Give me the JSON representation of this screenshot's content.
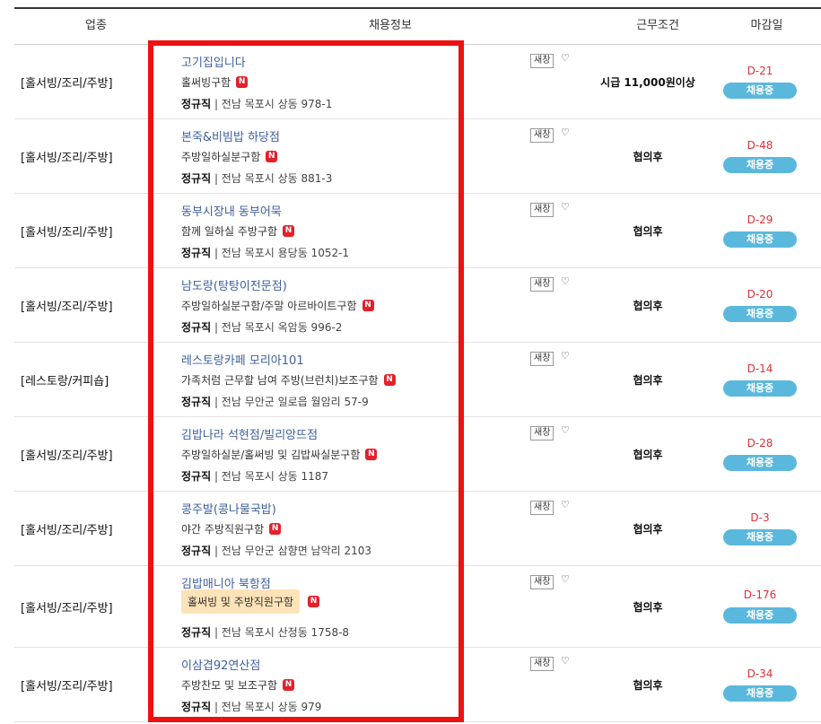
{
  "header": {
    "category": "업종",
    "info": "채용정보",
    "condition": "근무조건",
    "deadline": "마감일"
  },
  "labels": {
    "scrap": "새창",
    "new": "N",
    "heart": "♡"
  },
  "rows": [
    {
      "category": "[홀서빙/조리/주방]",
      "title": "고기집입니다",
      "desc": "홀써빙구함",
      "type": "정규직",
      "location": " | 전남 목포시 상동 978-1",
      "condition": "시급 11,000원이상",
      "dday": "D-21",
      "status": "채용중"
    },
    {
      "category": "[홀서빙/조리/주방]",
      "title": "본죽&비빔밥 하당점",
      "desc": "주방일하실분구함",
      "type": "정규직",
      "location": " | 전남 목포시 상동 881-3",
      "condition": "협의후",
      "dday": "D-48",
      "status": "채용중"
    },
    {
      "category": "[홀서빙/조리/주방]",
      "title": "동부시장내 동부어묵",
      "desc": "함께 일하실 주방구함",
      "type": "정규직",
      "location": " | 전남 목포시 용당동 1052-1",
      "condition": "협의후",
      "dday": "D-29",
      "status": "채용중"
    },
    {
      "category": "[홀서빙/조리/주방]",
      "title": "남도랑(탕탕이전문점)",
      "desc": "주방일하실분구함/주말 아르바이트구함",
      "type": "정규직",
      "location": " | 전남 목포시 옥암동 996-2",
      "condition": "협의후",
      "dday": "D-20",
      "status": "채용중"
    },
    {
      "category": "[레스토랑/커피숍]",
      "title": "레스토랑카페 모리아101",
      "desc": "가족처럼 근무할 남여 주방(브런치)보조구함",
      "type": "정규직",
      "location": " | 전남 무안군 일로읍 월암리 57-9",
      "condition": "협의후",
      "dday": "D-14",
      "status": "채용중"
    },
    {
      "category": "[홀서빙/조리/주방]",
      "title": "김밥나라 석현점/빌리앙뜨점",
      "desc": "주방일하실분/홀써빙 및 김밥싸실분구함",
      "type": "정규직",
      "location": " | 전남 목포시 상동 1187",
      "condition": "협의후",
      "dday": "D-28",
      "status": "채용중"
    },
    {
      "category": "[홀서빙/조리/주방]",
      "title": "콩주발(콩나물국밥)",
      "desc": "야간 주방직원구함",
      "type": "정규직",
      "location": " | 전남 무안군 삼향면 남악리 2103",
      "condition": "협의후",
      "dday": "D-3",
      "status": "채용중"
    },
    {
      "category": "[홀서빙/조리/주방]",
      "title": "김밥매니아 북항점",
      "desc": "홀써빙 및 주방직원구함",
      "type": "정규직",
      "location": " | 전남 목포시 산정동 1758-8",
      "condition": "협의후",
      "dday": "D-176",
      "status": "채용중"
    },
    {
      "category": "[홀서빙/조리/주방]",
      "title": "이삼겹92연산점",
      "desc": "주방찬모 및 보조구함",
      "type": "정규직",
      "location": " | 전남 목포시 상동 979",
      "condition": "협의후",
      "dday": "D-34",
      "status": "채용중"
    }
  ]
}
